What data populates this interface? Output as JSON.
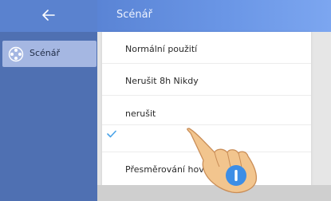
{
  "sidebar": {
    "back_icon": "arrow-left-icon",
    "items": [
      {
        "label": "Scénář",
        "icon": "scene-icon",
        "selected": true
      }
    ]
  },
  "header": {
    "title": "Scénář"
  },
  "dropdown": {
    "options": [
      {
        "label": "Normální použití"
      },
      {
        "label": "Nerušit 8h Nikdy"
      },
      {
        "label": "nerušit"
      },
      {
        "label": "",
        "checked": true
      },
      {
        "label": "Přesměrování hovoru Vždy"
      }
    ]
  },
  "colors": {
    "sidebar_bg": "#4f70b2",
    "header_bg": "#6a96e6",
    "selected_item_bg": "#a5b7e2",
    "check_color": "#4aa3e8"
  },
  "overlay": {
    "icon": "pointing-hand-icon"
  }
}
